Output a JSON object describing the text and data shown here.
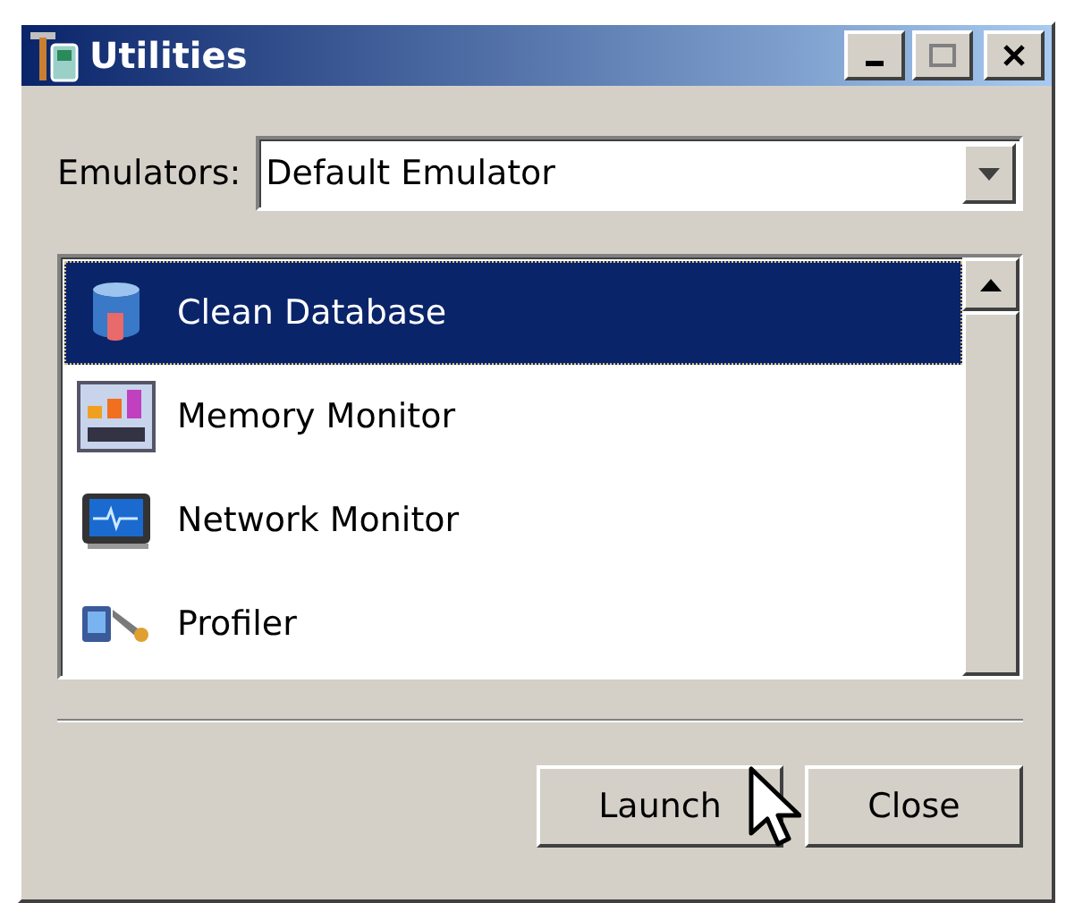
{
  "window": {
    "title": "Utilities"
  },
  "emulators": {
    "label": "Emulators:",
    "value": "Default Emulator"
  },
  "utilities": [
    {
      "label": "Clean Database",
      "kind": "database",
      "selected": true
    },
    {
      "label": "Memory Monitor",
      "kind": "ram",
      "selected": false
    },
    {
      "label": "Network Monitor",
      "kind": "monitor",
      "selected": false
    },
    {
      "label": "Profiler",
      "kind": "profiler",
      "selected": false
    }
  ],
  "buttons": [
    {
      "label": "Launch"
    },
    {
      "label": "Close"
    }
  ]
}
